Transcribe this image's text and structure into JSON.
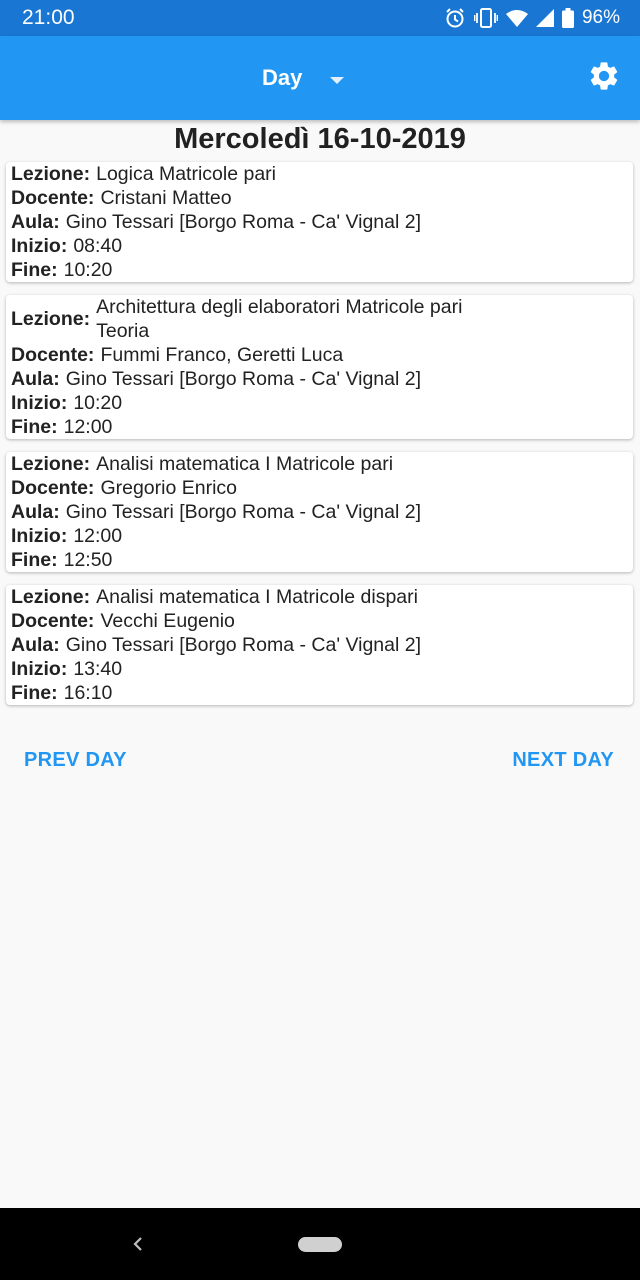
{
  "status_bar": {
    "time": "21:00",
    "battery_percent": "96%",
    "icons": [
      "alarm-icon",
      "vibrate-icon",
      "wifi-icon",
      "signal-icon",
      "battery-icon"
    ]
  },
  "app_bar": {
    "view_label": "Day",
    "dropdown_icon": "dropdown-arrow-icon",
    "settings_icon": "gear-icon"
  },
  "date_title": "Mercoledì 16-10-2019",
  "labels": {
    "lesson": "Lezione:",
    "teacher": "Docente:",
    "room": "Aula:",
    "start": "Inizio:",
    "end": "Fine:"
  },
  "lessons": [
    {
      "lesson": "Logica Matricole pari",
      "teacher": "Cristani Matteo",
      "room": "Gino Tessari [Borgo Roma - Ca' Vignal 2]",
      "start": "08:40",
      "end": "10:20"
    },
    {
      "lesson": "Architettura degli elaboratori Matricole pari\nTeoria",
      "teacher": "Fummi Franco, Geretti Luca",
      "room": "Gino Tessari [Borgo Roma - Ca' Vignal 2]",
      "start": "10:20",
      "end": "12:00"
    },
    {
      "lesson": "Analisi matematica I Matricole pari",
      "teacher": "Gregorio Enrico",
      "room": "Gino Tessari [Borgo Roma - Ca' Vignal 2]",
      "start": "12:00",
      "end": "12:50"
    },
    {
      "lesson": "Analisi matematica I Matricole dispari",
      "teacher": "Vecchi Eugenio",
      "room": "Gino Tessari [Borgo Roma - Ca' Vignal 2]",
      "start": "13:40",
      "end": "16:10"
    }
  ],
  "navigation": {
    "prev_label": "PREV DAY",
    "next_label": "NEXT DAY"
  },
  "system_nav": {
    "back_icon": "back-chevron-icon",
    "home_icon": "home-pill-icon"
  },
  "colors": {
    "status_bar": "#1976d2",
    "app_bar": "#2196f3",
    "accent": "#2196f3",
    "background": "#f9f9f9"
  }
}
